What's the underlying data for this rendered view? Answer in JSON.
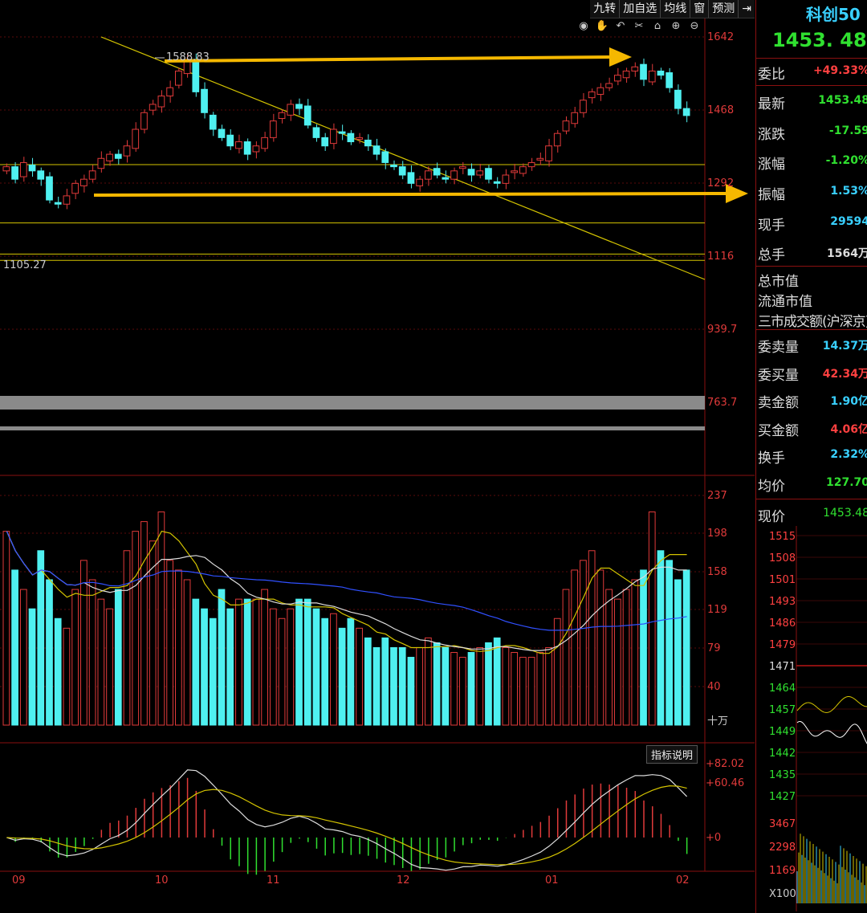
{
  "toolbar": {
    "nine_turn": "九转",
    "add_watch": "加自选",
    "ma_line": "均线",
    "window": "窗",
    "forecast": "预测",
    "close_icon": "pin-icon"
  },
  "chart_icons": [
    "eye-icon",
    "hand-icon",
    "undo-icon",
    "scissors-icon",
    "lock-icon",
    "zoom-in-icon",
    "zoom-out-icon"
  ],
  "price_axis": [
    "1642",
    "1468",
    "1292",
    "1116",
    "939.7",
    "763.7"
  ],
  "annotations": {
    "high": "1588.83",
    "low": "1105.27"
  },
  "volume_axis": [
    "237",
    "198",
    "158",
    "119",
    "79",
    "40",
    "十万"
  ],
  "indicator_axis": [
    "+82.02",
    "+60.46",
    "+0"
  ],
  "indicator_button": "指标说明",
  "time_axis": [
    "09",
    "10",
    "11",
    "12",
    "01",
    "02"
  ],
  "colors": {
    "up": "#e03a3a",
    "down": "#4ff0f0",
    "accent": "#f5b800",
    "green": "#30e030"
  },
  "side_panel": {
    "title": "科创50",
    "price": "1453. 48",
    "rows": [
      {
        "label": "委比",
        "value": "+49.33%",
        "color": "#ff4040"
      },
      {
        "label": "最新",
        "value": "1453.48",
        "color": "#30e030"
      },
      {
        "label": "涨跌",
        "value": "-17.59",
        "color": "#30e030"
      },
      {
        "label": "涨幅",
        "value": "-1.20%",
        "color": "#30e030"
      },
      {
        "label": "振幅",
        "value": "1.53%",
        "color": "#39d0ff"
      },
      {
        "label": "现手",
        "value": "29594",
        "color": "#39d0ff"
      },
      {
        "label": "总手",
        "value": "1564万",
        "color": "#ddd"
      }
    ],
    "rows2": [
      {
        "label": "总市值",
        "value": ""
      },
      {
        "label": "流通市值",
        "value": ""
      },
      {
        "label": "三市成交额(沪深京)",
        "value": ""
      }
    ],
    "rows3": [
      {
        "label": "委卖量",
        "value": "14.37万",
        "color": "#39d0ff"
      },
      {
        "label": "委买量",
        "value": "42.34万",
        "color": "#ff4040"
      },
      {
        "label": "卖金额",
        "value": "1.90亿",
        "color": "#39d0ff"
      },
      {
        "label": "买金额",
        "value": "4.06亿",
        "color": "#ff4040"
      },
      {
        "label": "换手",
        "value": "2.32%",
        "color": "#39d0ff"
      },
      {
        "label": "均价",
        "value": "127.70",
        "color": "#30e030"
      }
    ],
    "now_label": "现价",
    "now_value": "1453.48",
    "mini_axis": [
      "1515",
      "1508",
      "1501",
      "1493",
      "1486",
      "1479",
      "1471",
      "1464",
      "1457",
      "1449",
      "1442",
      "1435",
      "1427"
    ],
    "mini_vol_axis": [
      "3467",
      "2298",
      "1169",
      "X100"
    ]
  },
  "chart_data": {
    "type": "candlestick",
    "x_ticks": [
      "09",
      "10",
      "11",
      "12",
      "01",
      "02"
    ],
    "y_ticks": [
      1642,
      1468,
      1292,
      1116,
      939.7,
      763.7
    ],
    "ylim": [
      763.7,
      1642
    ],
    "high_label": 1588.83,
    "low_label": 1105.27,
    "closes": [
      1330,
      1300,
      1340,
      1320,
      1300,
      1250,
      1240,
      1260,
      1290,
      1300,
      1320,
      1350,
      1360,
      1350,
      1380,
      1420,
      1460,
      1480,
      1500,
      1520,
      1560,
      1588,
      1510,
      1460,
      1420,
      1400,
      1380,
      1390,
      1360,
      1380,
      1400,
      1440,
      1460,
      1480,
      1470,
      1430,
      1400,
      1380,
      1420,
      1410,
      1390,
      1400,
      1380,
      1360,
      1340,
      1330,
      1310,
      1290,
      1300,
      1320,
      1310,
      1300,
      1320,
      1330,
      1310,
      1320,
      1300,
      1290,
      1310,
      1320,
      1330,
      1340,
      1350,
      1380,
      1410,
      1440,
      1460,
      1490,
      1510,
      1520,
      1530,
      1550,
      1560,
      1570,
      1540,
      1560,
      1550,
      1520,
      1470,
      1453
    ],
    "volumes": [
      200,
      160,
      140,
      120,
      180,
      150,
      110,
      100,
      140,
      170,
      150,
      130,
      120,
      140,
      180,
      200,
      210,
      190,
      220,
      170,
      160,
      150,
      130,
      120,
      110,
      140,
      120,
      130,
      130,
      130,
      140,
      120,
      110,
      120,
      130,
      130,
      120,
      110,
      115,
      100,
      110,
      100,
      90,
      80,
      90,
      80,
      80,
      70,
      80,
      90,
      85,
      80,
      75,
      70,
      75,
      80,
      85,
      90,
      80,
      75,
      70,
      70,
      75,
      80,
      110,
      140,
      160,
      170,
      180,
      160,
      140,
      130,
      140,
      150,
      160,
      220,
      180,
      170,
      150,
      160
    ]
  }
}
